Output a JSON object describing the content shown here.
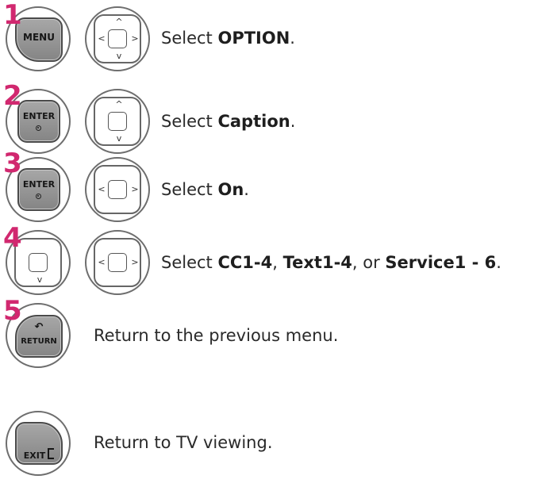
{
  "steps": [
    {
      "number": "1",
      "key_label": "MENU",
      "text_pre": "Select ",
      "text_bold": "OPTION",
      "text_post": "."
    },
    {
      "number": "2",
      "key_label": "ENTER",
      "text_pre": "Select ",
      "text_bold": "Caption",
      "text_post": "."
    },
    {
      "number": "3",
      "key_label": "ENTER",
      "text_pre": "Select ",
      "text_bold": "On",
      "text_post": "."
    },
    {
      "number": "4",
      "text_pre": "Select ",
      "bold_1": "CC1-4",
      "sep_1": ", ",
      "bold_2": "Text1-4",
      "sep_2": ", or ",
      "bold_3": "Service1 - 6",
      "text_post": "."
    },
    {
      "number": "5",
      "key_label": "RETURN",
      "text": "Return to the previous menu."
    },
    {
      "key_label": "EXIT",
      "text": "Return to TV viewing."
    }
  ],
  "colors": {
    "step_number": "#d1286f",
    "key_grey": "#949494",
    "outline": "#6e6e6e"
  },
  "icons": {
    "nav_arrows": [
      "arrow-up",
      "arrow-down",
      "arrow-left",
      "arrow-right"
    ],
    "enter_dot": "enter-dot",
    "return_arrow": "return-arrow",
    "exit_bracket": "exit-bracket"
  }
}
